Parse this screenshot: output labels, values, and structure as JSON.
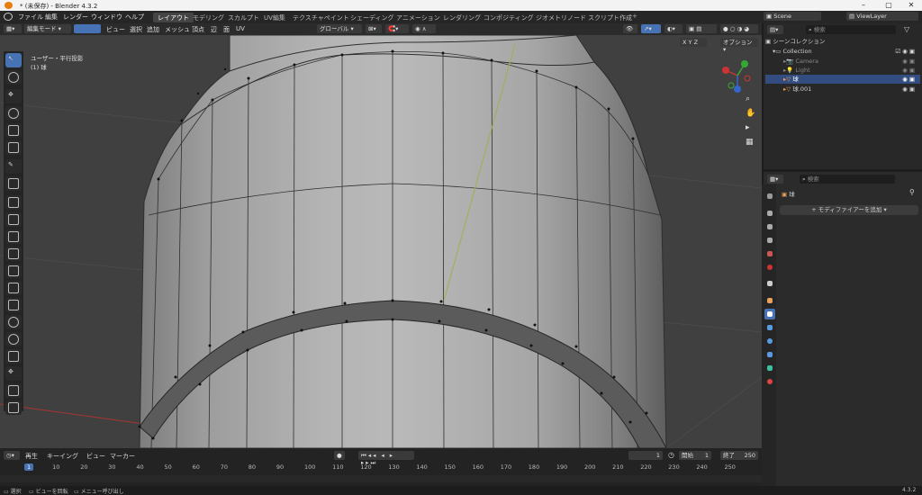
{
  "window": {
    "title": "* (未保存) - Blender 4.3.2"
  },
  "menu": [
    "ファイル",
    "編集",
    "レンダー",
    "ウィンドウ",
    "ヘルプ"
  ],
  "workspaces": [
    {
      "label": "レイアウト",
      "active": true
    },
    {
      "label": "モデリング"
    },
    {
      "label": "スカルプト"
    },
    {
      "label": "UV編集"
    },
    {
      "label": "テクスチャペイント"
    },
    {
      "label": "シェーディング"
    },
    {
      "label": "アニメーション"
    },
    {
      "label": "レンダリング"
    },
    {
      "label": "コンポジティング"
    },
    {
      "label": "ジオメトリノード"
    },
    {
      "label": "スクリプト作成"
    }
  ],
  "scene": {
    "name": "Scene",
    "view_layer": "ViewLayer"
  },
  "viewport_header": {
    "mode": "編集モード",
    "menus": [
      "ビュー",
      "選択",
      "追加",
      "メッシュ",
      "頂点",
      "辺",
      "面",
      "UV"
    ],
    "orientation": "グローバル",
    "options_label": "オプション",
    "axes": [
      "X",
      "Y",
      "Z"
    ]
  },
  "viewport": {
    "view_name": "ユーザー・平行投影",
    "object_label": "(1) 球"
  },
  "outliner": {
    "search_placeholder": "検索",
    "rows": [
      {
        "label": "シーンコレクション"
      },
      {
        "label": "Collection"
      },
      {
        "label": "Camera"
      },
      {
        "label": "Light"
      },
      {
        "label": "球",
        "selected": true
      },
      {
        "label": "球.001"
      }
    ]
  },
  "properties": {
    "search_placeholder": "検索",
    "object": "球",
    "add_modifier": "モディファイアーを追加"
  },
  "timeline": {
    "menus": [
      "再生",
      "キーイング",
      "ビュー",
      "マーカー"
    ],
    "current_frame": "1",
    "start_label": "開始",
    "start": "1",
    "end_label": "終了",
    "end": "250",
    "ticks": [
      "1",
      "10",
      "20",
      "30",
      "40",
      "50",
      "60",
      "70",
      "80",
      "90",
      "100",
      "110",
      "120",
      "130",
      "140",
      "150",
      "160",
      "170",
      "180",
      "190",
      "200",
      "210",
      "220",
      "230",
      "240",
      "250"
    ]
  },
  "status": {
    "select": "選択",
    "rotate": "ビューを回転",
    "menu": "メニュー呼び出し",
    "version": "4.3.2"
  }
}
